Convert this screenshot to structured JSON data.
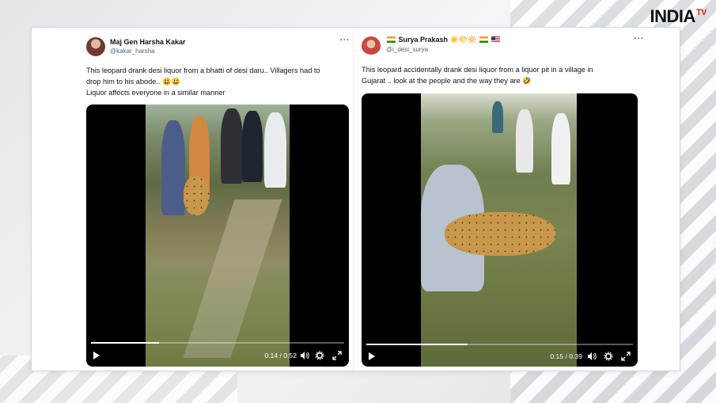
{
  "logo": {
    "brand": "INDIA",
    "suffix": "TV"
  },
  "tweets": [
    {
      "author_name": "Maj Gen Harsha Kakar",
      "handle": "@kakar_harsha",
      "more": "···",
      "text_lines": [
        "This leopard drank desi liquor from a bhatti of desi daru.. Villagers had to",
        "drop him to his abode.. 😃😃",
        "Liquor affects everyone in a similar manner"
      ],
      "video": {
        "time": "0:14 / 0:52",
        "progress": 0.27
      }
    },
    {
      "author_name": "Surya Prakash",
      "name_prefix_icon": "india-flag",
      "name_suffix_icons": [
        "sun-emoji",
        "sun-emoji",
        "sun-emoji",
        "india-flag",
        "us-flag"
      ],
      "name_suffix_emoji": "☀️🌕🔆",
      "handle": "@i_desi_surya",
      "more": "···",
      "text_lines": [
        "This leopard accidentally drank desi liquor from a liquor pit in a village in",
        "Gujarat .. look at the people and the way they are 🤣"
      ],
      "video": {
        "time": "0:15 / 0:39",
        "progress": 0.38
      }
    }
  ],
  "colors": {
    "logo_accent": "#e1251b",
    "text_primary": "#0f1419",
    "text_secondary": "#536471"
  }
}
